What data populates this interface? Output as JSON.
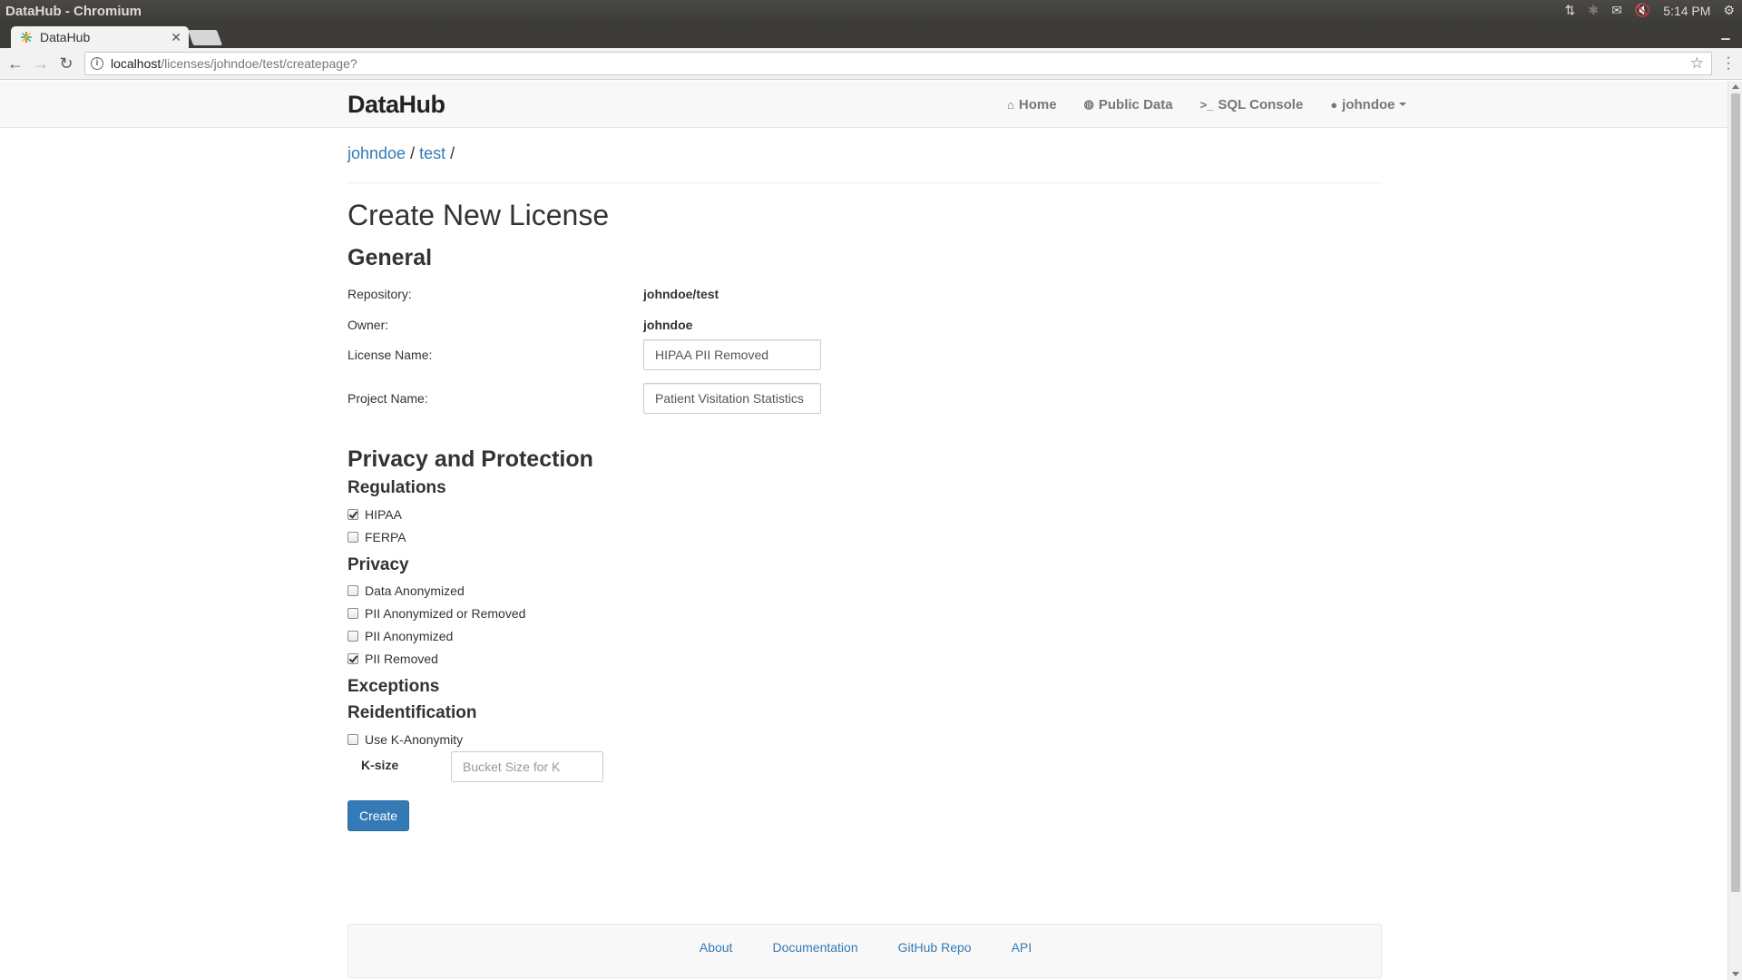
{
  "window": {
    "title": "DataHub - Chromium",
    "tray": {
      "time": "5:14 PM"
    }
  },
  "browser": {
    "tab_title": "DataHub",
    "url_host": "localhost",
    "url_path": "/licenses/johndoe/test/createpage?"
  },
  "navbar": {
    "brand": "DataHub",
    "links": [
      {
        "label": "Home",
        "icon": "home-icon"
      },
      {
        "label": "Public Data",
        "icon": "globe-icon"
      },
      {
        "label": "SQL Console",
        "icon": "terminal-icon"
      },
      {
        "label": "johndoe",
        "icon": "user-icon"
      }
    ]
  },
  "breadcrumb": {
    "owner": "johndoe",
    "sep1": "/",
    "repo": "test",
    "sep2": "/"
  },
  "page": {
    "title": "Create New License",
    "general_heading": "General",
    "repository_label": "Repository:",
    "repository_value": "johndoe/test",
    "owner_label": "Owner:",
    "owner_value": "johndoe",
    "license_name_label": "License Name:",
    "license_name_value": "HIPAA PII Removed",
    "project_name_label": "Project Name:",
    "project_name_value": "Patient Visitation Statistics",
    "privacy_heading": "Privacy and Protection",
    "regulations_heading": "Regulations",
    "regulations": [
      {
        "label": "HIPAA",
        "checked": true
      },
      {
        "label": "FERPA",
        "checked": false
      }
    ],
    "privacy_subheading": "Privacy",
    "privacy_options": [
      {
        "label": "Data Anonymized",
        "checked": false
      },
      {
        "label": "PII Anonymized or Removed",
        "checked": false
      },
      {
        "label": "PII Anonymized",
        "checked": false
      },
      {
        "label": "PII Removed",
        "checked": true
      }
    ],
    "exceptions_heading": "Exceptions",
    "reidentification_heading": "Reidentification",
    "k_anonymity": {
      "label": "Use K-Anonymity",
      "checked": false
    },
    "ksize_label": "K-size",
    "ksize_placeholder": "Bucket Size for K",
    "create_button": "Create"
  },
  "footer": {
    "links": [
      "About",
      "Documentation",
      "GitHub Repo",
      "API"
    ]
  }
}
